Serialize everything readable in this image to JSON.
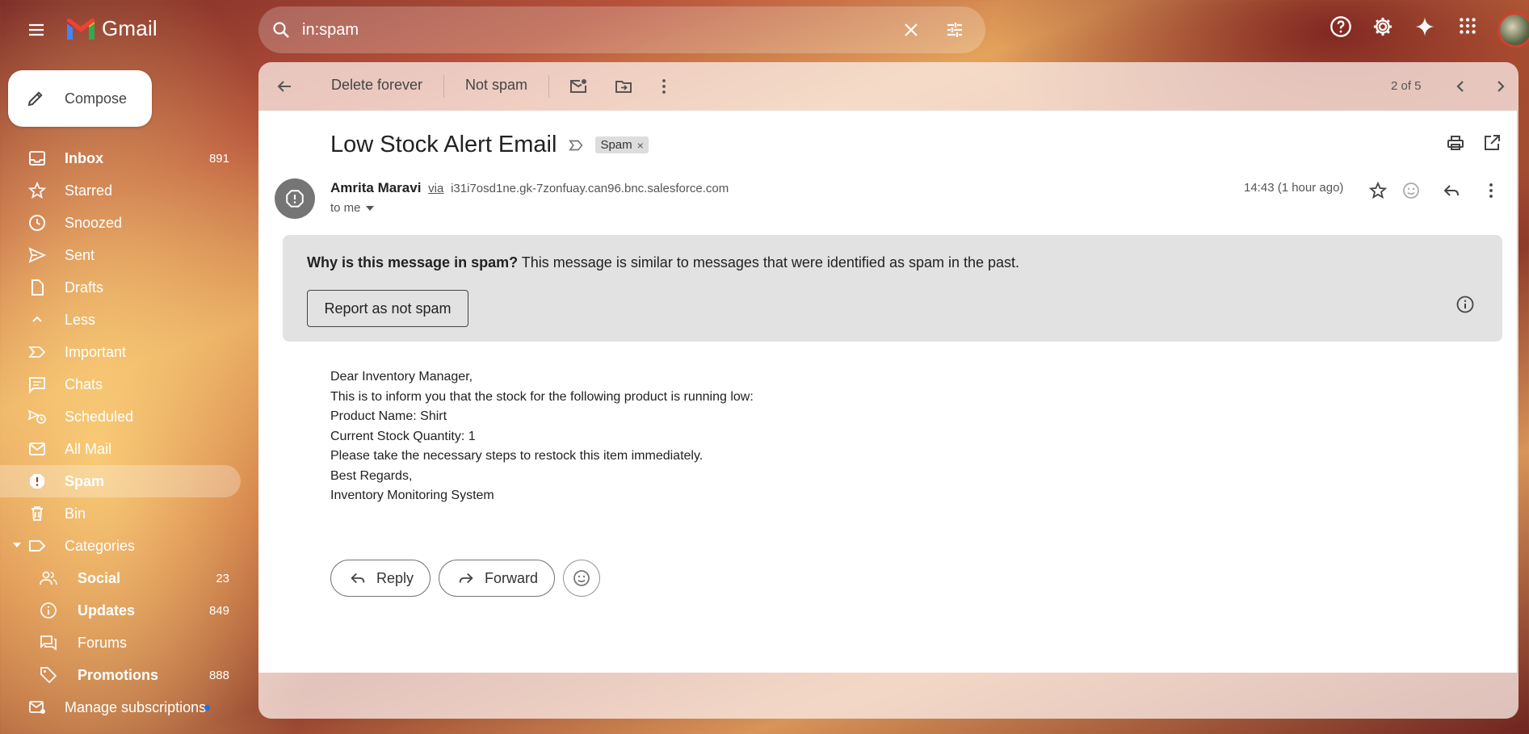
{
  "app": {
    "name": "Gmail"
  },
  "search": {
    "value": "in:spam"
  },
  "compose": {
    "label": "Compose"
  },
  "sidebar": {
    "items": [
      {
        "label": "Inbox",
        "count": "891",
        "icon": "inbox-icon"
      },
      {
        "label": "Starred",
        "count": "",
        "icon": "star-icon"
      },
      {
        "label": "Snoozed",
        "count": "",
        "icon": "clock-icon"
      },
      {
        "label": "Sent",
        "count": "",
        "icon": "send-icon"
      },
      {
        "label": "Drafts",
        "count": "",
        "icon": "draft-icon"
      },
      {
        "label": "Less",
        "count": "",
        "icon": "chevron-up-icon"
      },
      {
        "label": "Important",
        "count": "",
        "icon": "important-icon"
      },
      {
        "label": "Chats",
        "count": "",
        "icon": "chat-icon"
      },
      {
        "label": "Scheduled",
        "count": "",
        "icon": "scheduled-icon"
      },
      {
        "label": "All Mail",
        "count": "",
        "icon": "all-mail-icon"
      },
      {
        "label": "Spam",
        "count": "",
        "icon": "spam-icon"
      },
      {
        "label": "Bin",
        "count": "",
        "icon": "trash-icon"
      },
      {
        "label": "Categories",
        "count": "",
        "icon": "label-icon"
      },
      {
        "label": "Social",
        "count": "23",
        "icon": "people-icon"
      },
      {
        "label": "Updates",
        "count": "849",
        "icon": "info-icon"
      },
      {
        "label": "Forums",
        "count": "",
        "icon": "forum-icon"
      },
      {
        "label": "Promotions",
        "count": "888",
        "icon": "tag-icon"
      },
      {
        "label": "Manage subscriptions",
        "count": "",
        "icon": "subscriptions-icon"
      }
    ]
  },
  "toolbar": {
    "delete_forever": "Delete forever",
    "not_spam": "Not spam",
    "pager": "2 of 5"
  },
  "email": {
    "subject": "Low Stock Alert Email",
    "label_chip": "Spam",
    "sender_name": "Amrita Maravi",
    "via": "via",
    "sender_address": "i31i7osd1ne.gk-7zonfuay.can96.bnc.salesforce.com",
    "to": "to me",
    "time": "14:43 (1 hour ago)",
    "body": [
      "Dear Inventory Manager,",
      "This is to inform you that the stock for the following product is running low:",
      "Product Name: Shirt",
      "Current Stock Quantity: 1",
      "Please take the necessary steps to restock this item immediately.",
      "Best Regards,",
      "Inventory Monitoring System"
    ]
  },
  "spam_notice": {
    "question": "Why is this message in spam?",
    "explanation": " This message is similar to messages that were identified as spam in the past.",
    "report_button": "Report as not spam"
  },
  "actions": {
    "reply": "Reply",
    "forward": "Forward"
  }
}
